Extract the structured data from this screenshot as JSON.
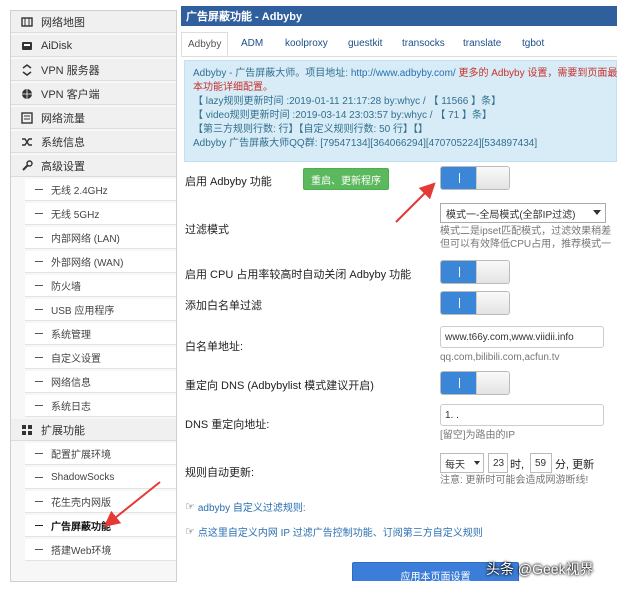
{
  "sidebar": {
    "items": [
      {
        "label": "网络地图",
        "icon": "map-icon"
      },
      {
        "label": "AiDisk",
        "icon": "disk-icon"
      },
      {
        "label": "VPN 服务器",
        "icon": "vpn-server-icon"
      },
      {
        "label": "VPN 客户端",
        "icon": "globe-icon"
      },
      {
        "label": "网络流量",
        "icon": "traffic-icon"
      },
      {
        "label": "系统信息",
        "icon": "shuffle-icon"
      },
      {
        "label": "高级设置",
        "icon": "wrench-icon"
      }
    ],
    "advanced_sub": [
      "无线 2.4GHz",
      "无线 5GHz",
      "内部网络 (LAN)",
      "外部网络 (WAN)",
      "防火墙",
      "USB 应用程序",
      "系统管理",
      "自定义设置",
      "网络信息",
      "系统日志"
    ],
    "ext_header": {
      "label": "扩展功能",
      "icon": "grid-icon"
    },
    "ext_sub": [
      "配置扩展环境",
      "ShadowSocks",
      "花生壳内网版",
      "广告屏蔽功能",
      "搭建Web环境"
    ]
  },
  "main": {
    "title": "广告屏蔽功能 - Adbyby",
    "tabs": [
      "Adbyby",
      "ADM",
      "koolproxy",
      "guestkit",
      "transocks",
      "translate",
      "tgbot"
    ],
    "info": {
      "line1_a": "Adbyby - 广告屏蔽大师。项目地址: ",
      "line1_link": "http://www.adbyby.com/",
      "line1_red": " 更多的 Adbyby 设置，需要到页面最下",
      "line2_red": "本功能详细配置。",
      "line3": "【 lazy规则更新时间 :2019-01-11 21:17:28 by:whyc / 【 11566 】条】",
      "line4": "【 video规则更新时间 :2019-03-14 23:03:57 by:whyc / 【 71 】条】",
      "line5": "【第三方规则行数: 行】【自定义规则行数: 50 行】【】",
      "line6": "Adbyby 广告屏蔽大师QQ群: [79547134][364066294][470705224][534897434]"
    },
    "enable_label": "启用 Adbyby 功能",
    "restart_button": "重启、更新程序",
    "filter_label": "过滤模式",
    "filter_value": "模式一-全局模式(全部IP过滤)",
    "filter_hint1": "模式二是ipset匹配模式，过滤效果稍差",
    "filter_hint2": "但可以有效降低CPU占用，推荐模式一",
    "cpu_label": "启用 CPU 占用率较高时自动关闭 Adbyby 功能",
    "whitelist_enable_label": "添加白名单过滤",
    "whitelist_addr_label": "白名单地址:",
    "whitelist_value": "www.t66y.com,www.viidii.info",
    "whitelist_hint": "qq.com,bilibili.com,acfun.tv",
    "redirect_label": "重定向 DNS (Adbybylist 模式建议开启)",
    "dns_label": "DNS 重定向地址:",
    "dns_value": "1.      .",
    "dns_hint": "[留空]为路由的IP",
    "auto_update_label": "规则自动更新:",
    "update_freq": "每天",
    "update_hour": "23",
    "hour_unit": "时,",
    "update_min": "59",
    "min_unit": "分, 更新",
    "update_note": "注意: 更新时可能会造成网游断线!",
    "link1": "adbyby 自定义过滤规则:",
    "link2": "点这里自定义内网 IP 过滤广告控制功能、订阅第三方自定义规则",
    "apply_button": "应用本页面设置",
    "hand_glyph": "☞"
  },
  "watermark": "头条 @Geek视界",
  "colors": {
    "title_bar": "#2f5f9c",
    "info_bg": "#d8ecf7",
    "toggle_on": "#3b86d6",
    "green_button": "#5cb85c",
    "apply_button": "#3b7dd8",
    "annotation_arrow": "#e53935"
  }
}
